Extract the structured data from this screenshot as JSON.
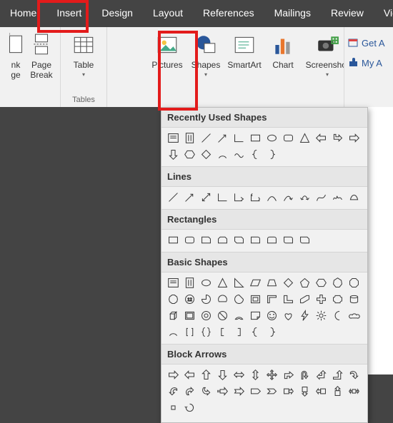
{
  "tabs": [
    {
      "label": "Home"
    },
    {
      "label": "Insert"
    },
    {
      "label": "Design"
    },
    {
      "label": "Layout"
    },
    {
      "label": "References"
    },
    {
      "label": "Mailings"
    },
    {
      "label": "Review"
    },
    {
      "label": "Vie"
    }
  ],
  "ribbon": {
    "groups": {
      "pages": {
        "label": "",
        "buttons": [
          {
            "label1": "nk",
            "label2": "ge"
          },
          {
            "label1": "Page",
            "label2": "Break"
          }
        ]
      },
      "tables": {
        "label": "Tables",
        "buttons": [
          {
            "label1": "Table",
            "label2": ""
          }
        ]
      },
      "illustrations": {
        "label": "",
        "buttons": [
          {
            "label1": "Pictures",
            "label2": ""
          },
          {
            "label1": "Shapes",
            "label2": ""
          },
          {
            "label1": "SmartArt",
            "label2": ""
          },
          {
            "label1": "Chart",
            "label2": ""
          },
          {
            "label1": "Screenshot",
            "label2": ""
          }
        ]
      }
    }
  },
  "right_links": {
    "get_addins": "Get A",
    "my_addins": "My A"
  },
  "shapes_menu": {
    "sections": [
      {
        "title": "Recently Used Shapes",
        "items": [
          "text-box",
          "vert-text-box",
          "line",
          "line-arrow",
          "corner-line",
          "rect",
          "oval",
          "rounded-rect",
          "triangle",
          "l-arrow",
          "r-corner-arrow",
          "right-arrow",
          "down-arrow",
          "hexagon-ish",
          "flow-decision",
          "arc",
          "wave",
          "brace-left",
          "brace-right"
        ]
      },
      {
        "title": "Lines",
        "items": [
          "line",
          "line-arrow",
          "double-arrow",
          "elbow",
          "elbow-arrow",
          "elbow-double",
          "curve",
          "curve-arrow",
          "curve-double",
          "freeform",
          "scribble",
          "freeform-closed"
        ]
      },
      {
        "title": "Rectangles",
        "items": [
          "rect",
          "rounded-rect",
          "snip-single",
          "snip-same",
          "snip-diag",
          "round-single",
          "round-same",
          "round-diag",
          "snip-round"
        ]
      },
      {
        "title": "Basic Shapes",
        "items": [
          "text-box",
          "vert-text-box",
          "oval",
          "triangle",
          "right-triangle",
          "parallelogram",
          "trapezoid",
          "diamond",
          "pentagon",
          "hexagon",
          "heptagon",
          "octagon",
          "decagon",
          "dodecagon",
          "pie",
          "chord",
          "teardrop",
          "frame",
          "half-frame",
          "l-shape",
          "diag-stripe",
          "plus",
          "plaque",
          "can",
          "cube",
          "bevel",
          "donut",
          "no-symbol",
          "block-arc",
          "folded-corner",
          "smiley",
          "heart",
          "lightning",
          "sun",
          "moon",
          "cloud",
          "arc2",
          "double-bracket",
          "double-brace",
          "bracket-left",
          "bracket-right",
          "brace-left",
          "brace-right"
        ]
      },
      {
        "title": "Block Arrows",
        "items": [
          "right-arrow",
          "left-arrow",
          "up-arrow",
          "down-arrow",
          "left-right-arrow",
          "up-down-arrow",
          "quad-arrow",
          "bent-arrow",
          "uturn-arrow",
          "left-up-arrow",
          "bent-up-arrow",
          "curved-right-arrow",
          "curved-left-arrow",
          "curved-up-arrow",
          "curved-down-arrow",
          "striped-right-arrow",
          "notched-right-arrow",
          "pentagon-arrow",
          "chevron",
          "right-callout",
          "down-callout",
          "left-callout",
          "up-callout",
          "lr-callout",
          "quad-callout",
          "circular-arrow"
        ]
      }
    ]
  }
}
